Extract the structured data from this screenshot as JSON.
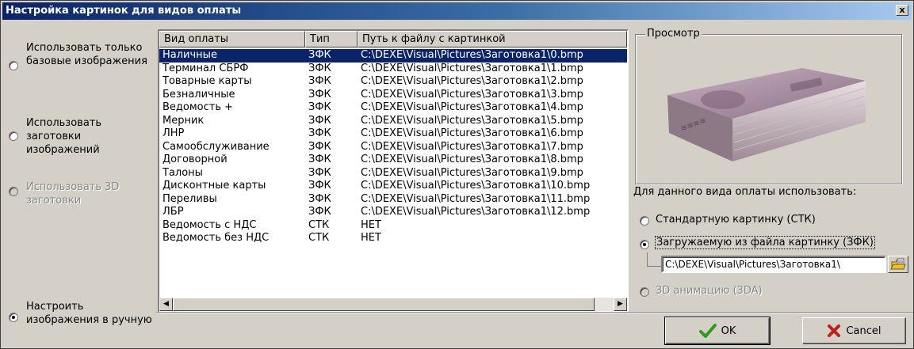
{
  "window": {
    "title": "Настройка картинок для видов оплаты",
    "close_label": "x"
  },
  "left_options": [
    {
      "label": "Использовать только базовые изображения",
      "checked": false,
      "enabled": true
    },
    {
      "label": "Использовать заготовки изображений",
      "checked": false,
      "enabled": true
    },
    {
      "label": "Использовать 3D заготовки",
      "checked": false,
      "enabled": false
    },
    {
      "label": "Настроить изображения в ручную",
      "checked": true,
      "enabled": true
    }
  ],
  "table": {
    "columns": [
      "Вид оплаты",
      "Тип",
      "Путь к файлу с картинкой"
    ],
    "rows": [
      [
        "Наличные",
        "ЗФК",
        "C:\\DEXE\\Visual\\Pictures\\Заготовка1\\0.bmp"
      ],
      [
        "Терминал СБРФ",
        "ЗФК",
        "C:\\DEXE\\Visual\\Pictures\\Заготовка1\\1.bmp"
      ],
      [
        "Товарные карты",
        "ЗФК",
        "C:\\DEXE\\Visual\\Pictures\\Заготовка1\\2.bmp"
      ],
      [
        "Безналичные",
        "ЗФК",
        "C:\\DEXE\\Visual\\Pictures\\Заготовка1\\3.bmp"
      ],
      [
        "Ведомость +",
        "ЗФК",
        "C:\\DEXE\\Visual\\Pictures\\Заготовка1\\4.bmp"
      ],
      [
        "Мерник",
        "ЗФК",
        "C:\\DEXE\\Visual\\Pictures\\Заготовка1\\5.bmp"
      ],
      [
        "ЛНР",
        "ЗФК",
        "C:\\DEXE\\Visual\\Pictures\\Заготовка1\\6.bmp"
      ],
      [
        "Самообслуживание",
        "ЗФК",
        "C:\\DEXE\\Visual\\Pictures\\Заготовка1\\7.bmp"
      ],
      [
        "Договорной",
        "ЗФК",
        "C:\\DEXE\\Visual\\Pictures\\Заготовка1\\8.bmp"
      ],
      [
        "Талоны",
        "ЗФК",
        "C:\\DEXE\\Visual\\Pictures\\Заготовка1\\9.bmp"
      ],
      [
        "Дисконтные карты",
        "ЗФК",
        "C:\\DEXE\\Visual\\Pictures\\Заготовка1\\10.bmp"
      ],
      [
        "Переливы",
        "ЗФК",
        "C:\\DEXE\\Visual\\Pictures\\Заготовка1\\11.bmp"
      ],
      [
        "ЛБР",
        "ЗФК",
        "C:\\DEXE\\Visual\\Pictures\\Заготовка1\\12.bmp"
      ],
      [
        "Ведомость с НДС",
        "СТК",
        "НЕТ"
      ],
      [
        "Ведомость без НДС",
        "СТК",
        "НЕТ"
      ]
    ],
    "selected_row": 0
  },
  "preview": {
    "legend": "Просмотр"
  },
  "usage": {
    "title": "Для данного вида оплаты использовать:",
    "options": [
      {
        "label": "Стандартную картинку (СТК)",
        "checked": false,
        "enabled": true
      },
      {
        "label": "Загружаемую из файла картинку (ЗФК)",
        "checked": true,
        "enabled": true
      },
      {
        "label": "3D анимацию (3DA)",
        "checked": false,
        "enabled": false
      }
    ],
    "path_value": "C:\\DEXE\\Visual\\Pictures\\Заготовка1\\"
  },
  "buttons": {
    "ok": "OK",
    "cancel": "Cancel"
  },
  "colors": {
    "selection": "#0a246a",
    "ok_check": "#2e9a1e",
    "cancel_x": "#c0201a"
  }
}
